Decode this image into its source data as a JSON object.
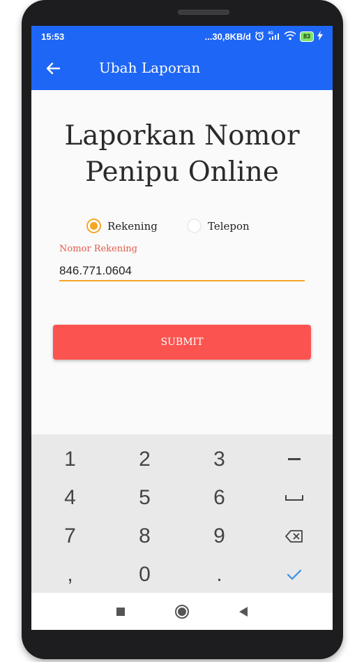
{
  "status_bar": {
    "time": "15:53",
    "net_speed": "...30,8KB/d",
    "battery": "83",
    "signal_label": "4G"
  },
  "app_bar": {
    "title": "Ubah Laporan"
  },
  "headline": {
    "line1": "Laporkan Nomor",
    "line2": "Penipu Online"
  },
  "report_type": {
    "options": [
      {
        "label": "Rekening",
        "checked": true
      },
      {
        "label": "Telepon",
        "checked": false
      }
    ]
  },
  "account_field": {
    "label": "Nomor Rekening",
    "value": "846.771.0604"
  },
  "submit_label": "SUBMIT",
  "keyboard": {
    "keys": [
      "1",
      "2",
      "3",
      "–",
      "4",
      "5",
      "6",
      "␣",
      "7",
      "8",
      "9",
      "⌫",
      ",",
      "0",
      ".",
      "✓"
    ]
  },
  "colors": {
    "primary": "#1e66f5",
    "accent": "#f5a623",
    "submit": "#fb5450",
    "label_red": "#e25b4b"
  }
}
